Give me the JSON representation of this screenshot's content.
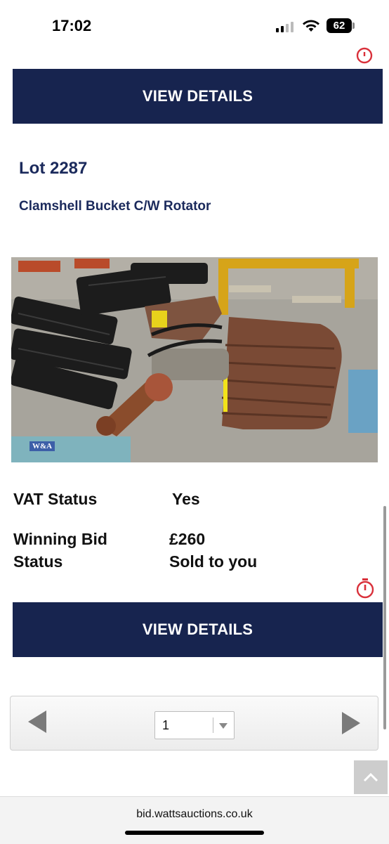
{
  "status_bar": {
    "time": "17:02",
    "battery": "62"
  },
  "top_button": {
    "label": "VIEW DETAILS"
  },
  "lot": {
    "title": "Lot 2287",
    "description": "Clamshell Bucket C/W Rotator",
    "image_watermark": "W&A",
    "vat_label": "VAT Status",
    "vat_value": "Yes",
    "winning_bid_label": "Winning Bid",
    "winning_bid_value": "£260",
    "status_label": "Status",
    "status_value": "Sold to you",
    "button_label": "VIEW DETAILS"
  },
  "pagination": {
    "current_page": "1"
  },
  "browser": {
    "url": "bid.wattsauctions.co.uk"
  },
  "colors": {
    "navy": "#17244f",
    "title": "#1b2a5c",
    "timer_red": "#d9303a"
  },
  "icons": [
    "cellular-signal-icon",
    "wifi-icon",
    "battery-icon",
    "timer-icon",
    "chevron-left-icon",
    "chevron-right-icon",
    "dropdown-caret-icon",
    "scroll-to-top-icon"
  ]
}
